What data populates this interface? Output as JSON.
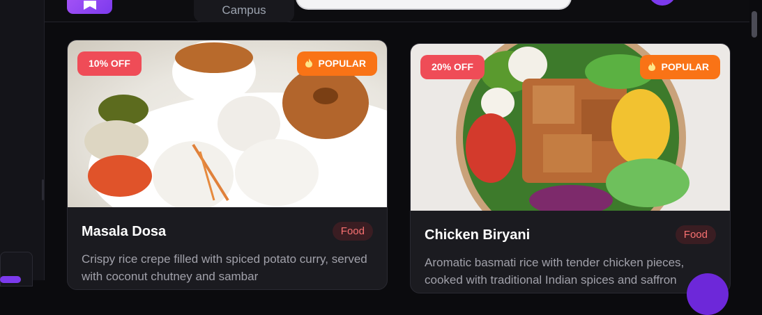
{
  "header": {
    "location_label": "Campus"
  },
  "products": [
    {
      "name": "Masala Dosa",
      "category": "Food",
      "discount_badge": "10% OFF",
      "popular_badge": "POPULAR",
      "description": "Crispy rice crepe filled with spiced potato curry, served with coconut chutney and sambar"
    },
    {
      "name": "Chicken Biryani",
      "category": "Food",
      "discount_badge": "20% OFF",
      "popular_badge": "POPULAR",
      "description": "Aromatic basmati rice with tender chicken pieces, cooked with traditional Indian spices and saffron"
    }
  ],
  "colors": {
    "accent": "#7c3aed",
    "discount": "#ef4c57",
    "popular": "#f97316",
    "category_text": "#f87171"
  },
  "icons": [
    "logo-icon",
    "flame-icon"
  ]
}
